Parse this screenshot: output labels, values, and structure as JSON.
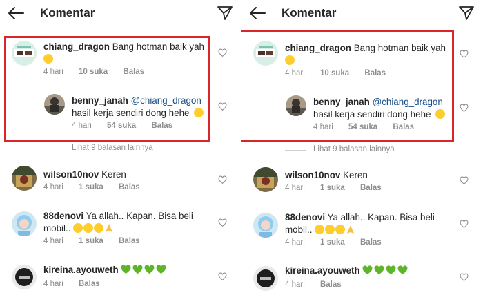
{
  "header": {
    "title": "Komentar"
  },
  "thread": {
    "comment": {
      "username": "chiang_dragon",
      "text": "Bang hotman baik yah",
      "time": "4 hari",
      "likes": "10 suka",
      "reply": "Balas"
    },
    "reply": {
      "username": "benny_janah",
      "mention": "@chiang_dragon",
      "text": "hasil kerja sendiri dong hehe",
      "time": "4 hari",
      "likes": "54 suka",
      "reply": "Balas"
    },
    "more_replies": "Lihat 9 balasan lainnya"
  },
  "comments": [
    {
      "username": "wilson10nov",
      "text": "Keren",
      "time": "4 hari",
      "likes": "1 suka",
      "reply": "Balas"
    },
    {
      "username": "88denovi",
      "text": "Ya allah.. Kapan. Bisa beli",
      "text2": "mobil..",
      "time": "4 hari",
      "likes": "1 suka",
      "reply": "Balas"
    },
    {
      "username": "kireina.ayouweth",
      "time": "4 hari",
      "reply": "Balas"
    }
  ],
  "colors": {
    "highlight": "#d9262b",
    "mention": "#1a4f8b",
    "muted": "#8e8e8e"
  }
}
